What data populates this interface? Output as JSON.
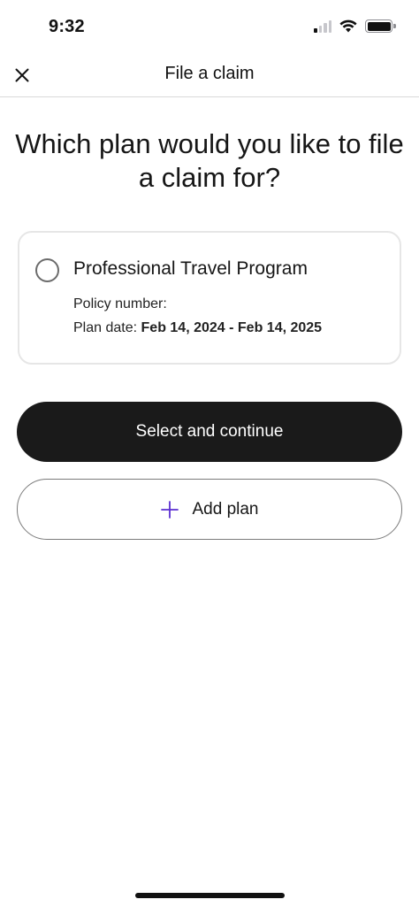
{
  "status_bar": {
    "time": "9:32"
  },
  "header": {
    "title": "File a claim",
    "close_icon": "close-icon"
  },
  "question": "Which plan would you like to file a claim for?",
  "plans": [
    {
      "name": "Professional Travel Program",
      "selected": false,
      "policy_label": "Policy number:",
      "policy_value": "",
      "date_label": "Plan date:",
      "date_value": "Feb 14, 2024 - Feb 14, 2025"
    }
  ],
  "actions": {
    "primary_label": "Select and continue",
    "secondary_label": "Add plan",
    "secondary_icon": "plus-icon"
  },
  "colors": {
    "primary_button": "#1a1a1a",
    "accent": "#5b2fd1",
    "card_border": "#e6e6e6"
  }
}
